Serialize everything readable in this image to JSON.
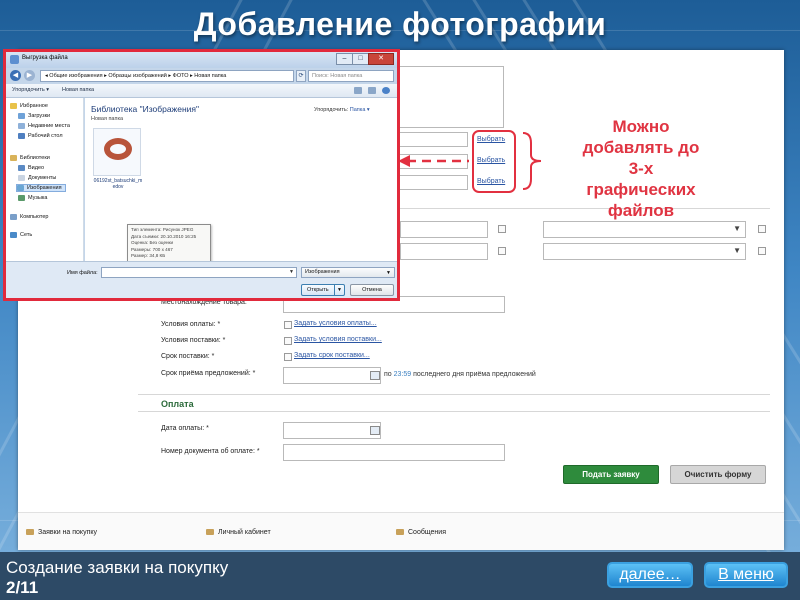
{
  "slide": {
    "title": "Добавление фотографии",
    "caption_line1": "Создание заявки на покупку",
    "caption_line2": "2/11",
    "next_label": "далее…",
    "menu_label": "В меню",
    "callout_lines": [
      "Можно",
      "добавлять до",
      "3-х",
      "графических",
      "файлов"
    ]
  },
  "colors": {
    "highlight_red": "#e23040",
    "submit_green": "#2e8b3c",
    "section_green": "#2b6a3a",
    "link_blue": "#2a55a3"
  },
  "dialog": {
    "title": "Выгрузка файла",
    "address": "◂  Общие изображения  ▸  Образцы изображений  ▸  ФОТО  ▸  Новая папка",
    "search_placeholder": "Поиск: Новая папка",
    "toolbar": {
      "organize": "Упорядочить ▾",
      "new_folder": "Новая папка"
    },
    "nav": {
      "favorites": "Избранное",
      "downloads": "Загрузки",
      "recent": "Недавние места",
      "desktop": "Рабочий стол",
      "libraries": "Библиотеки",
      "video": "Видео",
      "documents": "Документы",
      "images": "Изображения",
      "music": "Музыка",
      "computer": "Компьютер",
      "network": "Сеть"
    },
    "library_title": "Библиотека \"Изображения\"",
    "library_subtitle": "Новая папка",
    "arrange_label": "Упорядочить:",
    "arrange_value": "Папка ▾",
    "file_name": "06192st_batsuchki_medov",
    "tooltip": [
      "Тип элемента: Рисунок JPEG",
      "Дата съемки: 20.10.2010 16:25",
      "Оценка: Без оценки",
      "Размеры: 700 x 467",
      "Размер: 34,8 КБ"
    ],
    "file_name_label": "Имя файла:",
    "file_type": "Изображения",
    "open_label": "Открыть",
    "cancel_label": "Отмена"
  },
  "form": {
    "choose_label": "Выбрать",
    "location_label": "Местонахождение товара:",
    "payment_terms_label": "Условия оплаты: *",
    "payment_terms_link": "Задать условия оплаты...",
    "delivery_terms_label": "Условия поставки: *",
    "delivery_terms_link": "Задать условия поставки...",
    "delivery_time_label": "Срок поставки: *",
    "delivery_time_link": "Задать срок поставки...",
    "deadline_label": "Срок приёма предложений: *",
    "deadline_suffix_pre": "по ",
    "deadline_time": "23:59",
    "deadline_suffix_post": " последнего дня приёма предложений",
    "payment_section": "Оплата",
    "payment_date_label": "Дата оплаты: *",
    "payment_doc_label": "Номер документа об оплате: *",
    "submit_label": "Подать заявку",
    "clear_label": "Очистить форму"
  },
  "footer": {
    "purchase_requests": "Заявки на покупку",
    "cabinet": "Личный кабинет",
    "messages": "Сообщения"
  }
}
